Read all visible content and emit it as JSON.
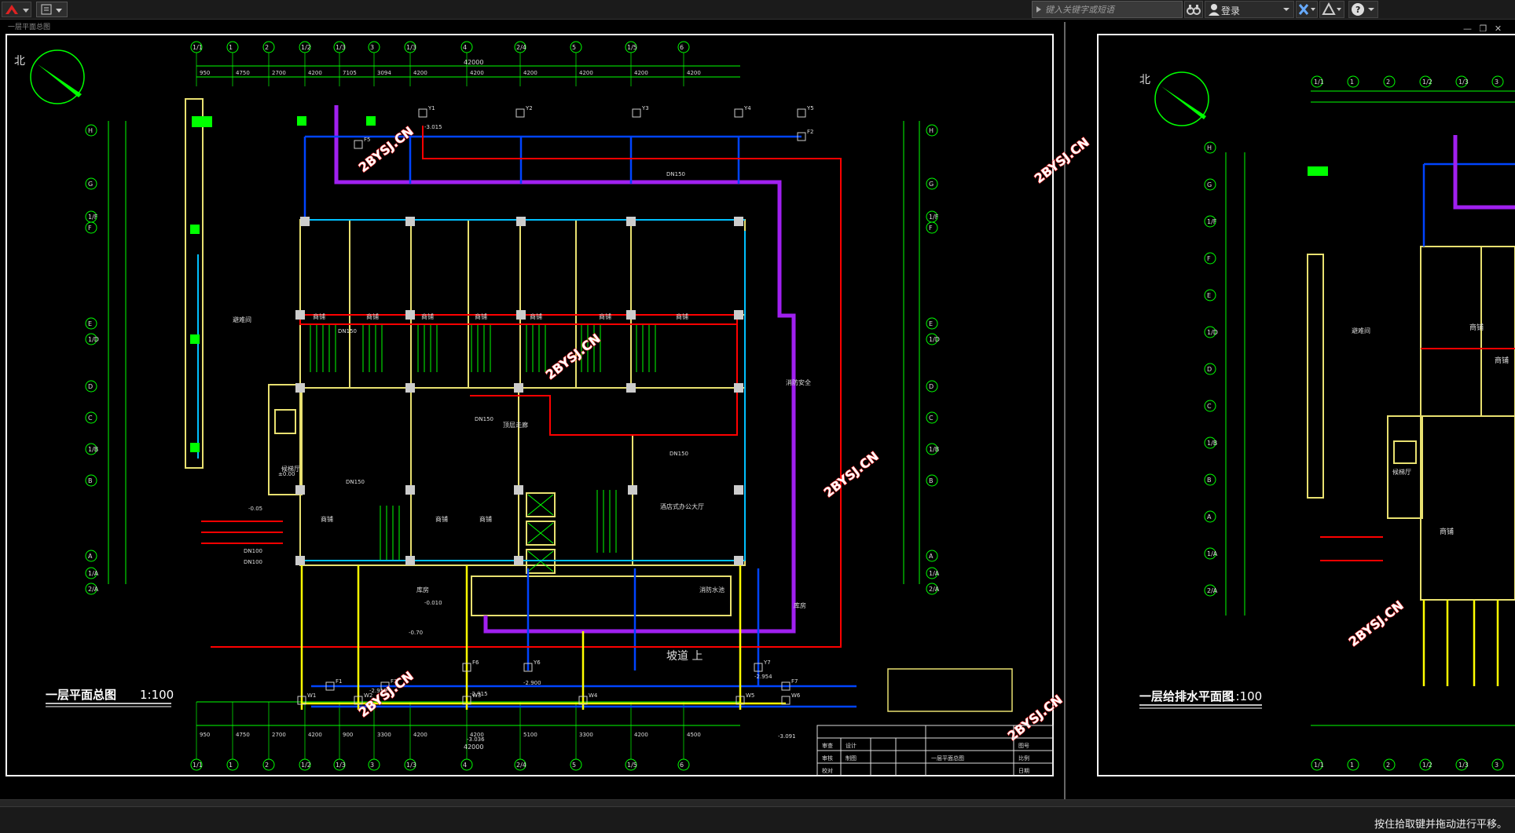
{
  "toolbar": {
    "search_placeholder": "键入关键字或短语",
    "login_label": "登录",
    "doc_title": "一层平面总图"
  },
  "drawing_left": {
    "title": "一层平面总图",
    "scale": "1:100",
    "north": "北",
    "row_axes": [
      "H",
      "G",
      "1/F",
      "F",
      "E",
      "1/D",
      "D",
      "C",
      "1/B",
      "B",
      "A",
      "1/A",
      "2/A"
    ],
    "col_axes": [
      "1/1",
      "1",
      "2",
      "1/2",
      "1/3",
      "3",
      "1/3",
      "4",
      "2/4",
      "5",
      "1/5",
      "6"
    ],
    "top_dims": [
      "950",
      "4750",
      "2700",
      "4200",
      "7105",
      "3094",
      "4200",
      "4200",
      "4200",
      "4200",
      "4200",
      "4200"
    ],
    "total_dim": "42000",
    "bottom_dims": [
      "950",
      "4750",
      "2700",
      "4200",
      "900",
      "3300",
      "4200",
      "4200",
      "5100",
      "3300",
      "4200",
      "4500"
    ],
    "rooms": [
      "商铺",
      "商铺",
      "商铺",
      "商铺",
      "商铺",
      "商铺",
      "商铺",
      "商铺",
      "商铺",
      "商铺",
      "消防安全",
      "消防水池",
      "避难间",
      "顶层走廊",
      "酒店式办公大厅",
      "候梯厅",
      "库房",
      "库房"
    ],
    "pipe_labels": [
      "DN150",
      "DN150",
      "DN150",
      "DN150",
      "DN150",
      "DN100",
      "DN100"
    ],
    "elevations": [
      "±0.00",
      "-0.05",
      "-0.70",
      "-0.010",
      "-2.900",
      "-2.913",
      "-2.915",
      "-2.954",
      "-3.015",
      "-3.036",
      "-3.091"
    ],
    "manholes": [
      "Y1",
      "Y2",
      "Y3",
      "Y4",
      "Y5",
      "Y6",
      "Y7",
      "W1",
      "W2",
      "W3",
      "W4",
      "W5",
      "W6",
      "F1",
      "F2",
      "F3",
      "F5",
      "F6",
      "F7"
    ],
    "watermark": "2BYSJ.CN",
    "ramp": "坡道 上",
    "title_block": [
      "审查",
      "审核",
      "校对",
      "设计",
      "制图",
      "一层平面总图",
      "图号",
      "日期",
      "比例"
    ]
  },
  "drawing_right": {
    "title": "一层给排水平面图",
    "scale": "1:100",
    "north": "北",
    "rooms": [
      "商铺",
      "商铺",
      "避难间",
      "候梯厅",
      "商铺"
    ],
    "watermark": "2BYSJ.CN"
  },
  "status": {
    "prompt": "按住拾取键并拖动进行平移。"
  },
  "colors": {
    "background": "#000000",
    "axis": "#00ff00",
    "wall": "#e8e070",
    "water_supply": "#0044ff",
    "drain": "#00c0ff",
    "fire": "#ff0000",
    "boundary": "#a020f0",
    "watermark": "#ff3030"
  }
}
